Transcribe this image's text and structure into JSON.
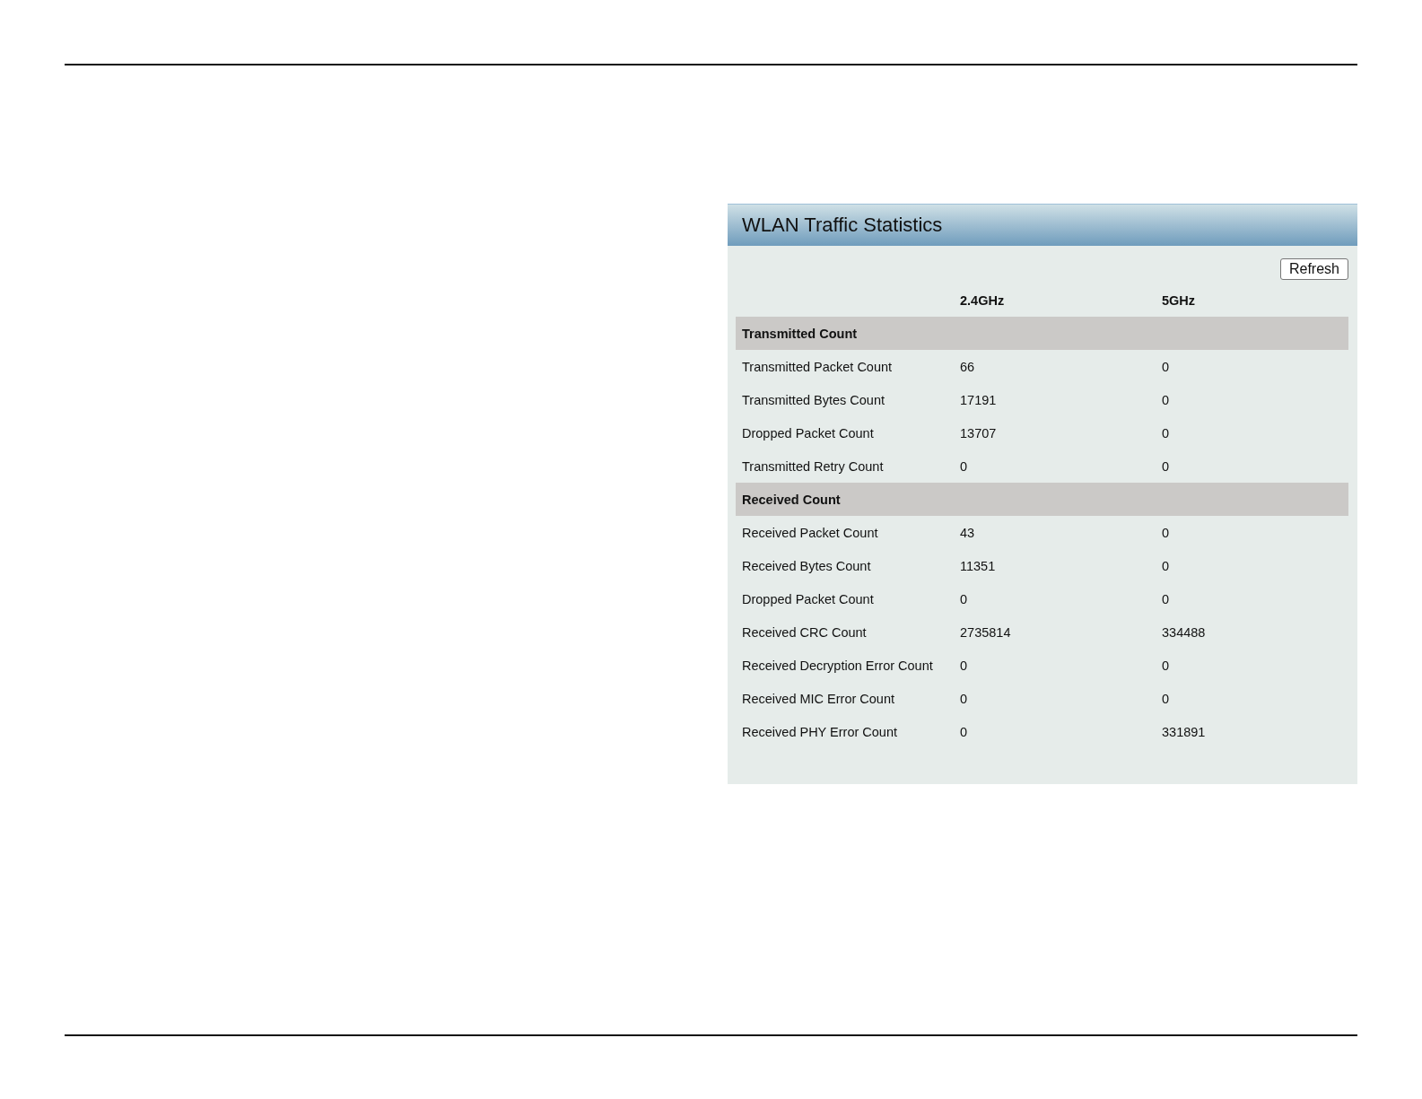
{
  "panel": {
    "title": "WLAN Traffic Statistics",
    "refresh_button": "Refresh",
    "columns": [
      "2.4GHz",
      "5GHz"
    ],
    "sections": [
      {
        "heading": "Transmitted Count",
        "rows": [
          {
            "label": "Transmitted Packet Count",
            "values": [
              "66",
              "0"
            ]
          },
          {
            "label": "Transmitted Bytes Count",
            "values": [
              "17191",
              "0"
            ]
          },
          {
            "label": "Dropped Packet Count",
            "values": [
              "13707",
              "0"
            ]
          },
          {
            "label": "Transmitted Retry Count",
            "values": [
              "0",
              "0"
            ]
          }
        ]
      },
      {
        "heading": "Received Count",
        "rows": [
          {
            "label": "Received Packet Count",
            "values": [
              "43",
              "0"
            ]
          },
          {
            "label": "Received Bytes Count",
            "values": [
              "11351",
              "0"
            ]
          },
          {
            "label": "Dropped Packet Count",
            "values": [
              "0",
              "0"
            ]
          },
          {
            "label": "Received CRC Count",
            "values": [
              "2735814",
              "334488"
            ]
          },
          {
            "label": "Received Decryption Error Count",
            "values": [
              "0",
              "0"
            ]
          },
          {
            "label": "Received MIC Error Count",
            "values": [
              "0",
              "0"
            ]
          },
          {
            "label": "Received PHY Error Count",
            "values": [
              "0",
              "331891"
            ]
          }
        ]
      }
    ]
  }
}
